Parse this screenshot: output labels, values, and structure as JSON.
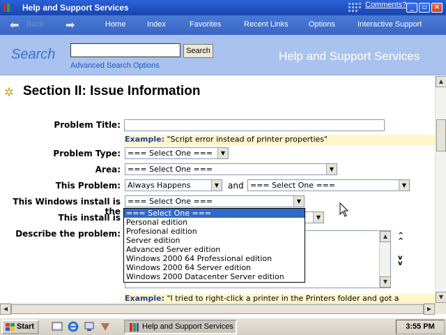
{
  "window": {
    "title": "Help and Support Services",
    "comments_link": "Comments?"
  },
  "nav": {
    "back_label": "Back",
    "items": [
      "Home",
      "Index",
      "Favorites",
      "Recent Links",
      "Options",
      "Interactive Support"
    ]
  },
  "search": {
    "label": "Search",
    "input_value": "",
    "button_label": "Search",
    "advanced_link": "Advanced Search Options",
    "header_title": "Help and Support Services"
  },
  "section": {
    "title": "Section II: Issue Information"
  },
  "form": {
    "problem_title_label": "Problem Title:",
    "problem_title_value": "",
    "problem_title_example_prefix": "Example:",
    "problem_title_example": "\"Script error instead of printer properties\"",
    "problem_type_label": "Problem Type:",
    "problem_type_value": "=== Select One ===",
    "area_label": "Area:",
    "area_value": "=== Select One ===",
    "this_problem_label": "This Problem:",
    "this_problem_value": "Always Happens",
    "and_label": "and",
    "this_problem_second_value": "=== Select One ===",
    "install_label": "This Windows install is the",
    "install_value": "=== Select One ===",
    "install_options": [
      "=== Select One ===",
      "Personal edition",
      "Profesional edition",
      "Server edition",
      "Advanced Server edition",
      "Windows 2000 64 Professional edition",
      "Windows 2000 64 Server edition",
      "Windows 2000 Datacenter Server edition"
    ],
    "install_is_label": "This install is",
    "describe_label": "Describe the problem:",
    "describe_example_prefix": "Example:",
    "describe_example": "\"I tried to right-click a printer in the Printers folder and got a"
  },
  "taskbar": {
    "start_label": "Start",
    "task_label": "Help and Support Services",
    "clock": "3:55 PM"
  },
  "colors": {
    "titlebar": "#1f4fc0",
    "navbar": "#4a7ad6",
    "searchbar": "#a9c3ee",
    "selection": "#316ac5",
    "example_bg": "#fff6cc"
  }
}
